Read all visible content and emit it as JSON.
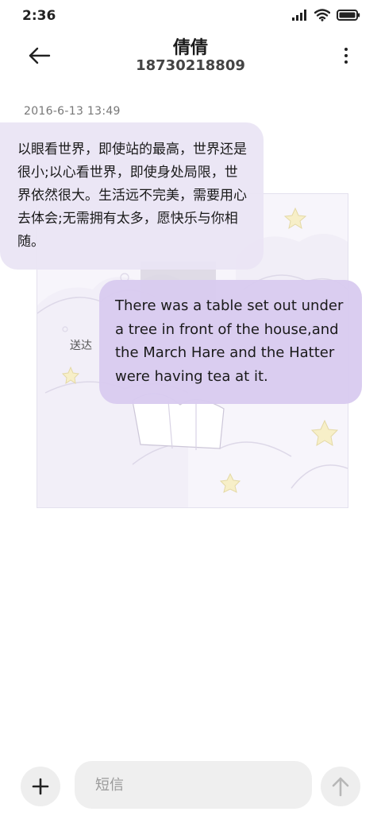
{
  "status_bar": {
    "time": "2:36",
    "icons": [
      "signal-icon",
      "wifi-icon",
      "battery-icon"
    ]
  },
  "header": {
    "contact_name": "倩倩",
    "phone_number": "18730218809",
    "icons": [
      "back-arrow-icon",
      "more-vertical-icon"
    ]
  },
  "conversation": {
    "timestamp": "2016-6-13 13:49",
    "incoming_message": "以眼看世界，即使站的最高，世界还是很小;以心看世界，即使身处局限，世界依然很大。生活远不完美，需要用心去体会;无需拥有太多，愿快乐与你相随。",
    "outgoing_message": "There was a table set out under a tree in front of the house,and the March Hare and the Hatter were having tea at it.",
    "delivery_status": "送达"
  },
  "composer": {
    "placeholder": "短信",
    "icons": [
      "plus-icon",
      "send-arrow-icon"
    ]
  },
  "colors": {
    "incoming_bubble": "#eae4f4",
    "outgoing_bubble": "#d8cbef",
    "input_background": "#efefef"
  }
}
